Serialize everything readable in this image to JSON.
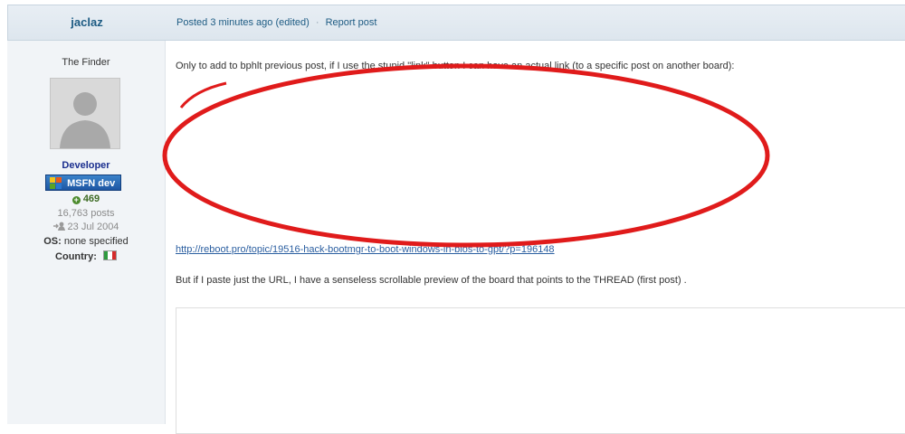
{
  "author": {
    "name": "jaclaz",
    "title": "The Finder",
    "role": "Developer",
    "badge": "MSFN dev",
    "reputation": "469",
    "posts": "16,763 posts",
    "joined": "23 Jul 2004",
    "os_label": "OS:",
    "os_value": "none specified",
    "country_label": "Country:"
  },
  "post": {
    "meta_posted": "Posted",
    "meta_time": "3 minutes ago",
    "meta_edited": "(edited)",
    "meta_sep": "·",
    "report": "Report post",
    "paragraph1": "Only to add to bphlt previous post, if I use the stupid \"link\" button I can have an actual link (to a specific post on another board):",
    "link": "http://reboot.pro/topic/19516-hack-bootmgr-to-boot-windows-in-bios-to-gpt/?p=196148",
    "paragraph2": "But if I paste just the URL, I have a senseless scrollable preview of the board that points to the THREAD (first post) ."
  },
  "colors": {
    "annotation": "#e01b1b",
    "badge": "#1d56a3",
    "role": "#1b2f8f"
  },
  "icons": {
    "avatar": "default-avatar-icon",
    "reputation": "plus-circle-icon",
    "joined": "user-arrow-icon",
    "flag": "italy-flag-icon",
    "badge_logo": "puzzle-icon"
  }
}
